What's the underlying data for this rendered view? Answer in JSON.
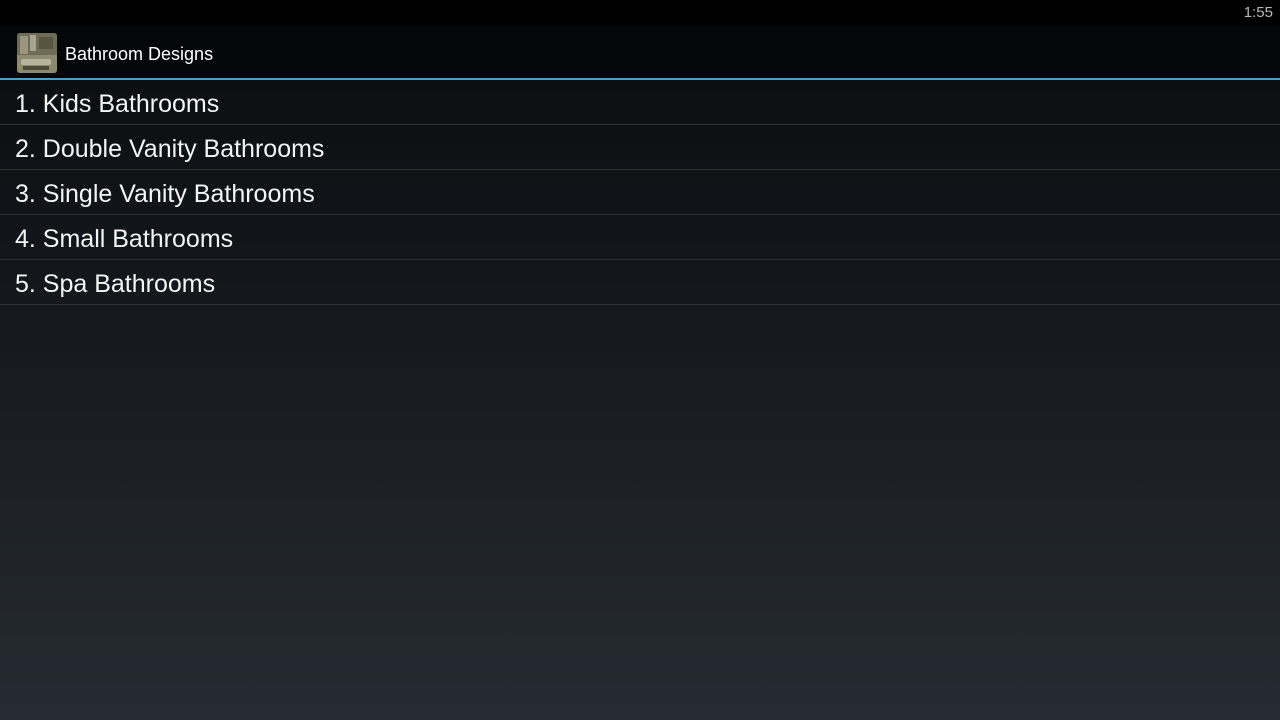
{
  "status_bar": {
    "clock": "1:55"
  },
  "action_bar": {
    "app_icon": "bathroom-photo-icon",
    "title": "Bathroom Designs"
  },
  "list": {
    "items": [
      {
        "label": "1. Kids Bathrooms"
      },
      {
        "label": "2. Double Vanity Bathrooms"
      },
      {
        "label": "3. Single Vanity Bathrooms"
      },
      {
        "label": "4. Small Bathrooms"
      },
      {
        "label": "5. Spa Bathrooms"
      }
    ]
  },
  "colors": {
    "accent_divider": "#4a9fc8",
    "status_bar_bg": "#000000",
    "action_bar_bg": "#050607",
    "text": "#ffffff"
  }
}
